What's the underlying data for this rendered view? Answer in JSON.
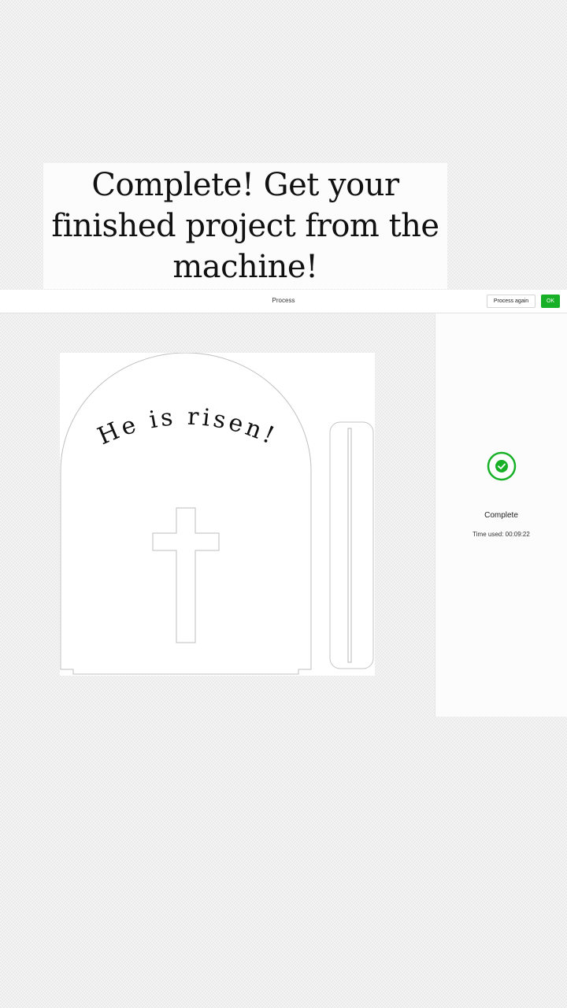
{
  "overlay": {
    "caption": "Complete! Get your finished project from the machine!"
  },
  "header": {
    "title": "Process",
    "process_again_label": "Process again",
    "ok_label": "OK"
  },
  "design": {
    "engraved_text": "He is risen!",
    "icons": [
      "cross-cutout",
      "stand-piece"
    ]
  },
  "status": {
    "title": "Complete",
    "time_label": "Time used: 00:09:22",
    "icon": "check-circle-icon",
    "accent_color": "#17b026"
  }
}
